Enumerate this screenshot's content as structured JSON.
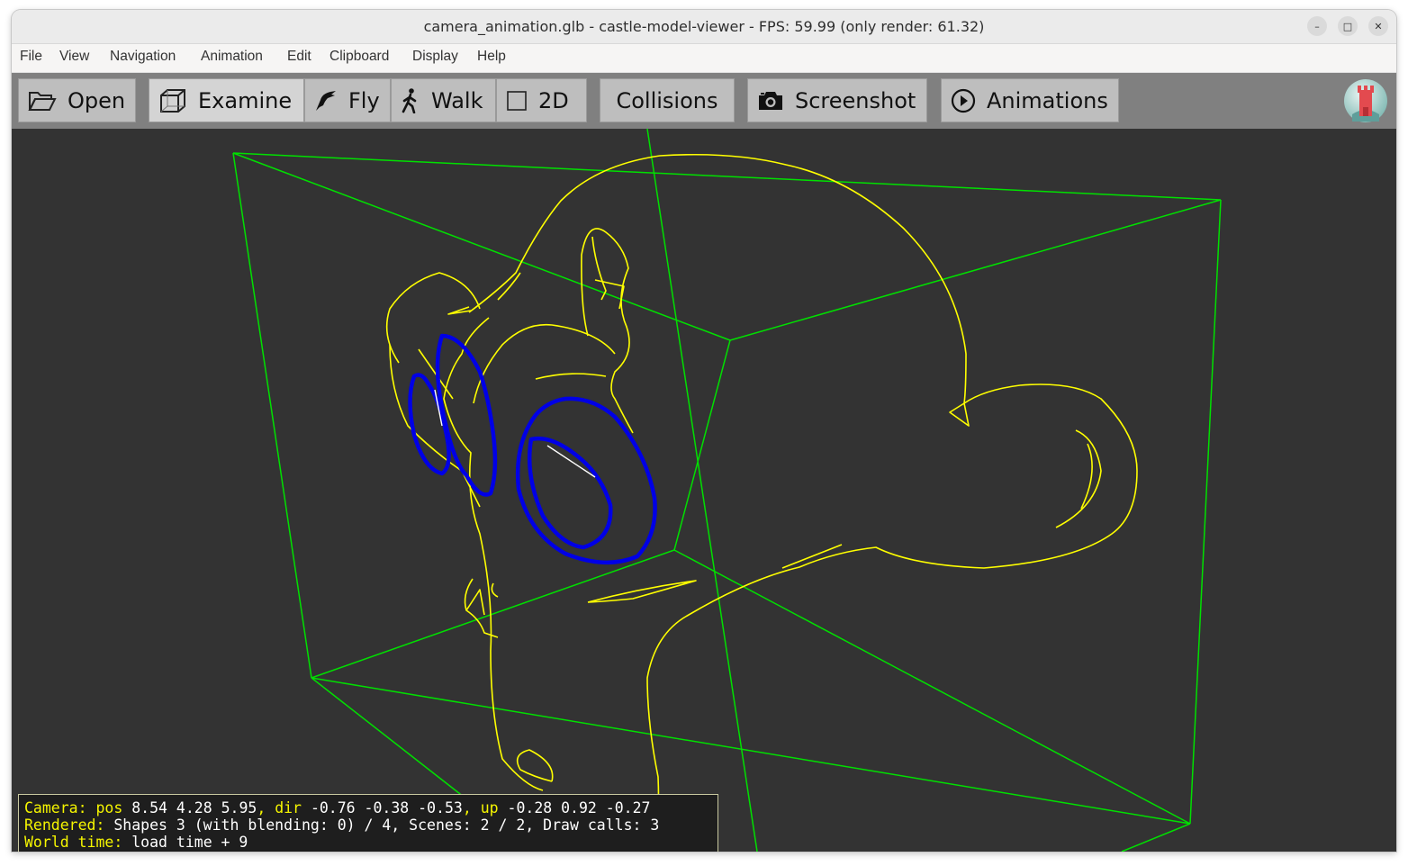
{
  "window": {
    "title": "camera_animation.glb - castle-model-viewer - FPS: 59.99 (only render: 61.32)",
    "controls": {
      "minimize": "–",
      "maximize": "□",
      "close": "✕"
    }
  },
  "menu": {
    "items": [
      {
        "label": "File"
      },
      {
        "label": "View"
      },
      {
        "label": "Navigation"
      },
      {
        "label": "Animation"
      },
      {
        "label": "Edit"
      },
      {
        "label": "Clipboard"
      },
      {
        "label": "Display"
      },
      {
        "label": "Help"
      }
    ]
  },
  "toolbar": {
    "open": {
      "label": "Open",
      "icon": "folder-open-icon"
    },
    "examine": {
      "label": "Examine",
      "icon": "cube-icon",
      "selected": true
    },
    "fly": {
      "label": "Fly",
      "icon": "bird-icon"
    },
    "walk": {
      "label": "Walk",
      "icon": "walking-person-icon"
    },
    "two_d": {
      "label": "2D",
      "icon": "square-icon"
    },
    "collisions": {
      "label": "Collisions"
    },
    "screenshot": {
      "label": "Screenshot",
      "icon": "camera-icon"
    },
    "animations": {
      "label": "Animations",
      "icon": "play-circle-icon"
    },
    "logo_icon": "castle-logo-icon"
  },
  "viewport": {
    "background_color": "#333333",
    "bbox_color": "#00e000",
    "wire_color": "#ffff00",
    "highlight_color": "#0000e6"
  },
  "status": {
    "camera_label": "Camera:",
    "pos_label": "pos",
    "pos_value": "8.54 4.28 5.95",
    "dir_label": "dir",
    "dir_value": "-0.76 -0.38 -0.53",
    "up_label": "up",
    "up_value": "-0.28 0.92 -0.27",
    "rendered_label": "Rendered:",
    "rendered_value": "Shapes 3 (with blending: 0) / 4, Scenes: 2 / 2, Draw calls: 3",
    "world_time_label": "World time:",
    "world_time_value": "load time + 9"
  }
}
